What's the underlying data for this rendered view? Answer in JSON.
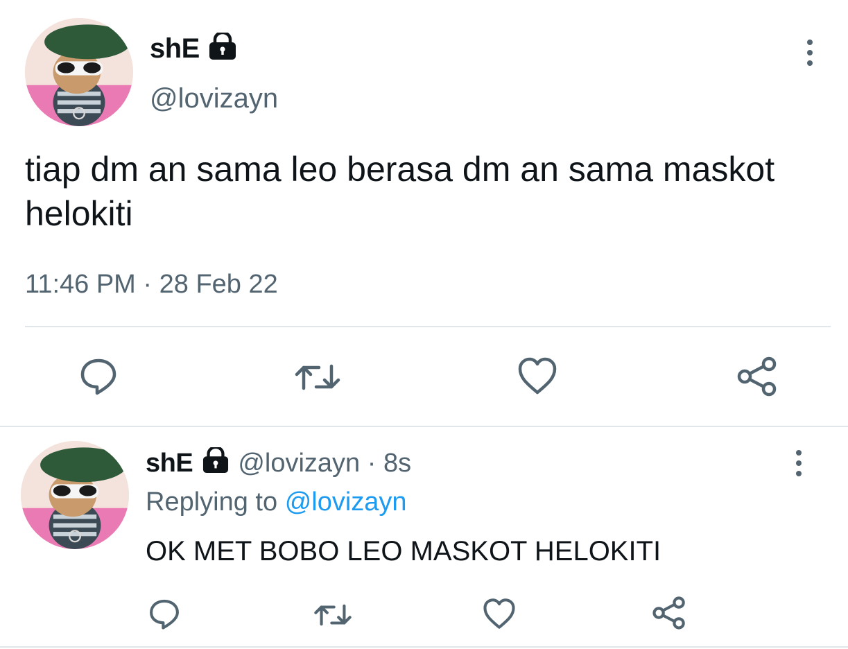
{
  "main_tweet": {
    "display_name": "shE",
    "handle": "@lovizayn",
    "text": "tiap dm an sama leo berasa dm an sama maskot helokiti",
    "time": "11:46 PM",
    "date_sep": "·",
    "date": "28 Feb 22"
  },
  "reply_tweet": {
    "display_name": "shE",
    "handle": "@lovizayn",
    "dot": "·",
    "age": "8s",
    "replying_prefix": "Replying to",
    "replying_handle": "@lovizayn",
    "text": "OK MET BOBO LEO MASKOT HELOKITI"
  },
  "icons": {
    "reply": "reply-icon",
    "retweet": "retweet-icon",
    "like": "heart-icon",
    "share": "share-icon",
    "more": "more-options-icon",
    "lock": "lock-icon"
  },
  "colors": {
    "text": "#0f1419",
    "muted": "#536471",
    "link": "#1d9bf0",
    "divider": "#e1e6ea"
  }
}
